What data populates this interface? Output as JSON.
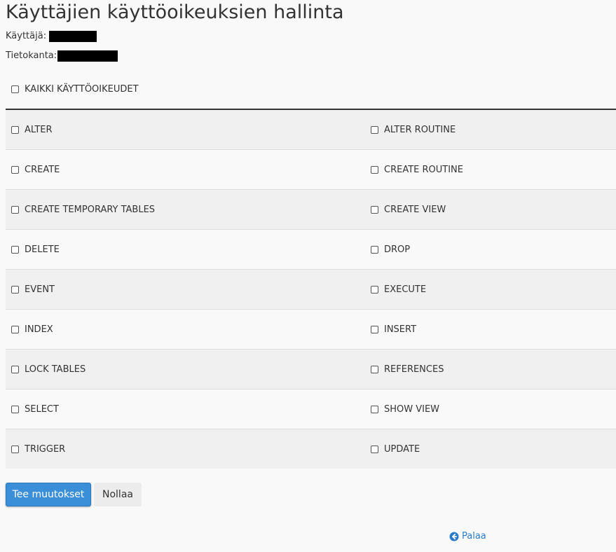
{
  "title": "Käyttäjien käyttöoikeuksien hallinta",
  "user_label": "Käyttäjä:",
  "database_label": "Tietokanta:",
  "all_privileges_label": "KAIKKI KÄYTTÖOIKEUDET",
  "privileges": [
    [
      "ALTER",
      "ALTER ROUTINE"
    ],
    [
      "CREATE",
      "CREATE ROUTINE"
    ],
    [
      "CREATE TEMPORARY TABLES",
      "CREATE VIEW"
    ],
    [
      "DELETE",
      "DROP"
    ],
    [
      "EVENT",
      "EXECUTE"
    ],
    [
      "INDEX",
      "INSERT"
    ],
    [
      "LOCK TABLES",
      "REFERENCES"
    ],
    [
      "SELECT",
      "SHOW VIEW"
    ],
    [
      "TRIGGER",
      "UPDATE"
    ]
  ],
  "buttons": {
    "submit": "Tee muutokset",
    "reset": "Nollaa"
  },
  "back_link": "Palaa",
  "colors": {
    "primary_button": "#3b8fd9",
    "link": "#2a7bc8",
    "row_shade": "#f0f0f0",
    "background": "#f9f9f9"
  }
}
